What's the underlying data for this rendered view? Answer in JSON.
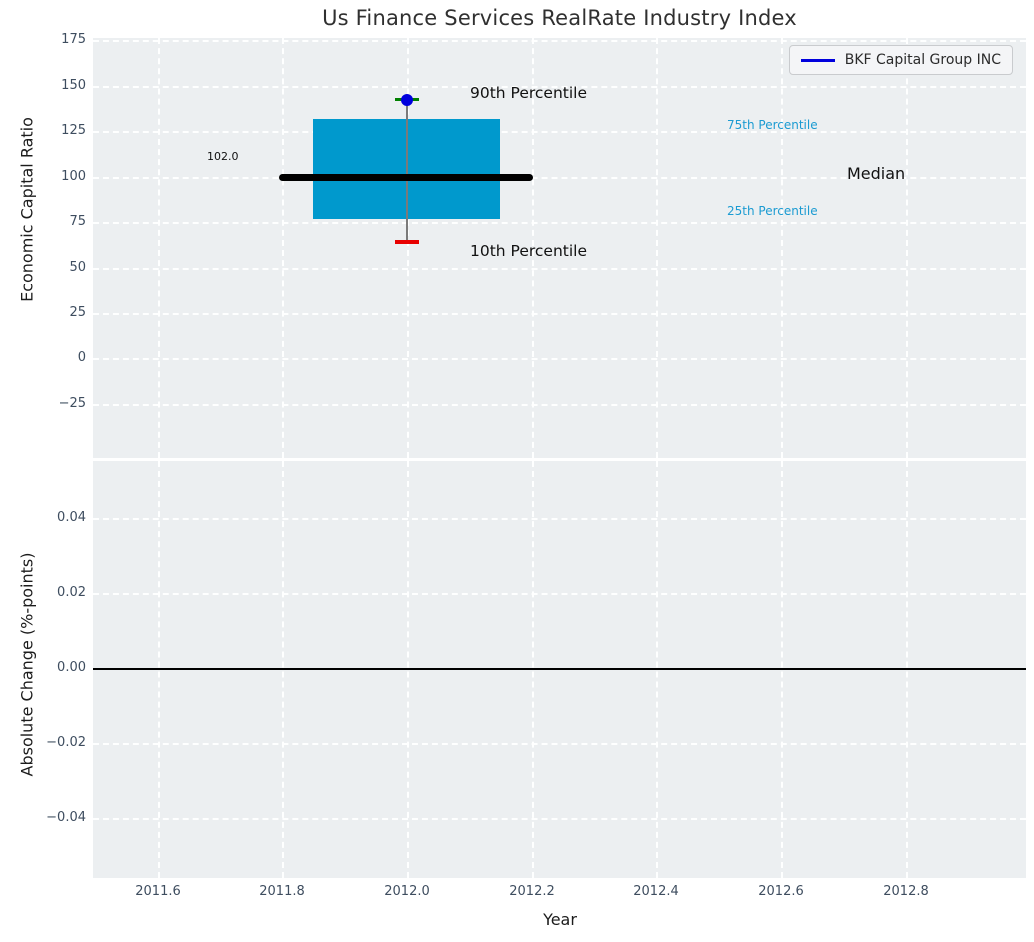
{
  "colors": {
    "plot_background": "#ECEFF1",
    "grid_line": "#FFFFFF",
    "box_fill": "#0099CD",
    "median_line": "#000000",
    "whisker": "#7A7A7A",
    "upper_cap": "#008000",
    "lower_cap": "#E80000",
    "marker_and_legend_line": "#0000DD",
    "percentile_label_text": "#1B9BD2",
    "tick_label_text": "#3E4D5F"
  },
  "chart_data": [
    {
      "type": "box",
      "title": "Us Finance Services RealRate Industry Index",
      "ylabel": "Economic Capital Ratio",
      "xlabel": "Year",
      "legend": [
        "BKF Capital Group INC"
      ],
      "legend_position": "upper right",
      "grid": true,
      "x": 2012.0,
      "box": {
        "x_center": 2012.0,
        "box_x_range": [
          2011.85,
          2012.15
        ],
        "median_x_range": [
          2011.8,
          2012.2
        ],
        "p10": 65,
        "p25": 78,
        "median": 102.0,
        "p75": 132,
        "p90": 142
      },
      "annotations": {
        "p90": "90th Percentile",
        "p10": "10th Percentile",
        "p75": "75th Percentile",
        "p25": "25th Percentile",
        "median": "Median",
        "median_value": "102.0"
      },
      "yticks": [
        175,
        150,
        125,
        100,
        75,
        50,
        25,
        0,
        -25
      ],
      "y_tick_labels": [
        "175",
        "150",
        "125",
        "100",
        "75",
        "50",
        "25",
        "0",
        "−25"
      ],
      "xticks": [
        2011.6,
        2011.8,
        2012.0,
        2012.2,
        2012.4,
        2012.6,
        2012.8
      ],
      "x_tick_labels": [
        "2011.6",
        "2011.8",
        "2012.0",
        "2012.2",
        "2012.4",
        "2012.6",
        "2012.8"
      ],
      "ylim": [
        -55,
        176
      ],
      "xlim": [
        2011.5,
        2013.0
      ]
    },
    {
      "type": "line",
      "ylabel": "Absolute Change (%-points)",
      "series": [],
      "zero_line": 0.0,
      "grid": true,
      "yticks": [
        0.04,
        0.02,
        0.0,
        -0.02,
        -0.04
      ],
      "y_tick_labels": [
        "0.04",
        "0.02",
        "0.00",
        "−0.02",
        "−0.04"
      ],
      "ylim": [
        -0.055,
        0.055
      ],
      "xlim": [
        2011.5,
        2013.0
      ]
    }
  ]
}
